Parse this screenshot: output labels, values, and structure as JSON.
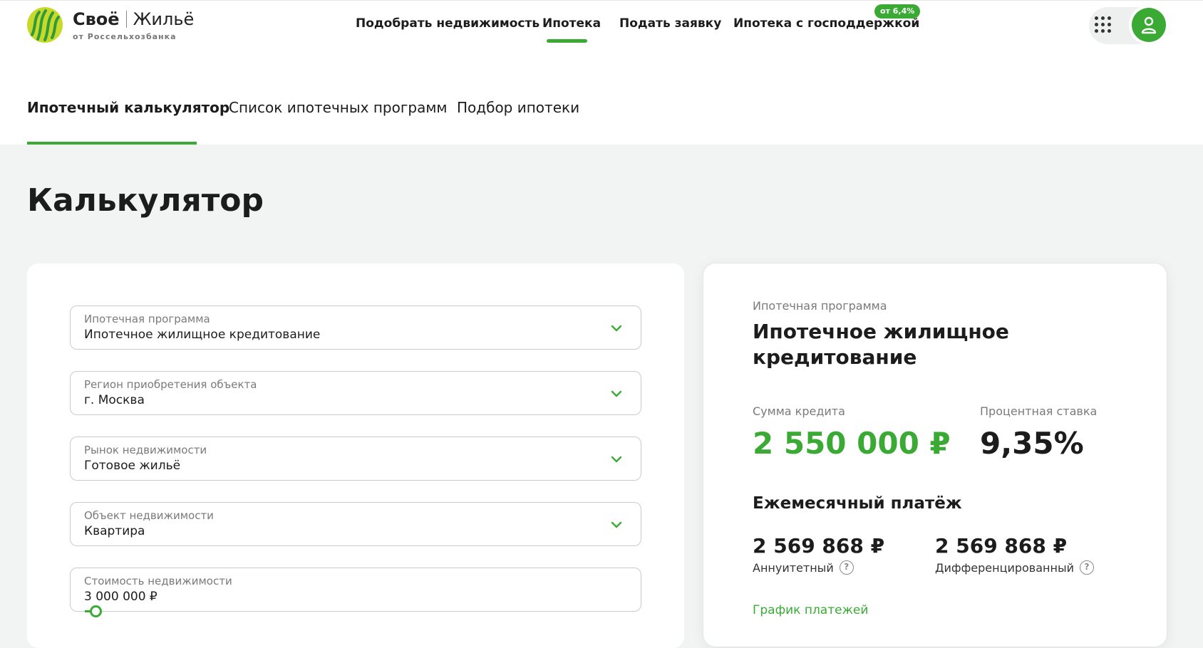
{
  "colors": {
    "accent": "#3aaa35",
    "text": "#1c1c1c",
    "muted": "#7a7a7a",
    "background": "#f2f3f3"
  },
  "header": {
    "logo": {
      "title_bold": "Своё",
      "title_light": "Жильё",
      "subtitle": "от Россельхозбанка"
    },
    "nav": [
      {
        "label": "Подобрать недвижимость",
        "active": false
      },
      {
        "label": "Ипотека",
        "active": true
      },
      {
        "label": "Подать заявку",
        "active": false
      },
      {
        "label": "Ипотека с господдержкой",
        "active": false
      }
    ],
    "badge": "от 6,4%",
    "icons": {
      "apps": "grid-icon",
      "profile": "user-icon"
    }
  },
  "subnav": {
    "tabs": [
      {
        "label": "Ипотечный калькулятор",
        "active": true
      },
      {
        "label": "Список ипотечных программ",
        "active": false
      },
      {
        "label": "Подбор ипотеки",
        "active": false
      }
    ]
  },
  "page": {
    "title": "Калькулятор"
  },
  "form": {
    "fields": [
      {
        "label": "Ипотечная программа",
        "value": "Ипотечное жилищное кредитование"
      },
      {
        "label": "Регион приобретения объекта",
        "value": "г. Москва"
      },
      {
        "label": "Рынок недвижимости",
        "value": "Готовое жильё"
      },
      {
        "label": "Объект недвижимости",
        "value": "Квартира"
      },
      {
        "label": "Стоимость недвижимости",
        "value": "3 000 000 ₽",
        "slider_fraction": 0.02
      }
    ]
  },
  "summary": {
    "program_label": "Ипотечная программа",
    "program_name": "Ипотечное жилищное кредитование",
    "loan_label": "Сумма кредита",
    "loan_value": "2 550 000 ₽",
    "rate_label": "Процентная ставка",
    "rate_value": "9,35%",
    "monthly_heading": "Ежемесячный платёж",
    "annuity_value": "2 569 868 ₽",
    "annuity_label": "Аннуитетный",
    "diff_value": "2 569 868 ₽",
    "diff_label": "Дифференцированный",
    "schedule_link": "График платежей"
  }
}
